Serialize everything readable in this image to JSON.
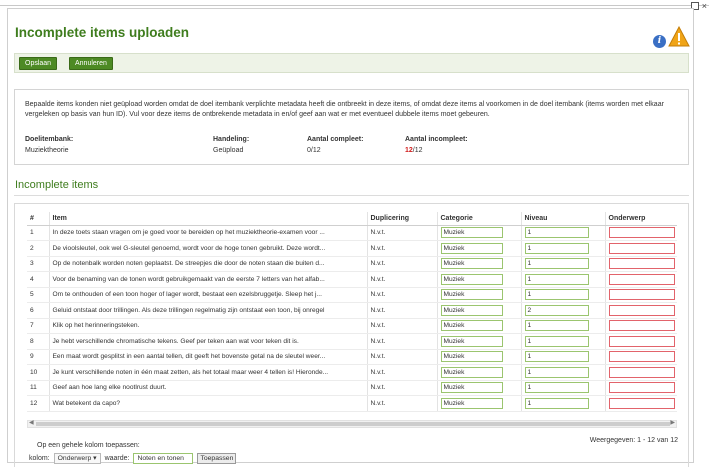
{
  "window": {
    "maximize_glyph": "□",
    "close_glyph": "×"
  },
  "page": {
    "title": "Incomplete items uploaden"
  },
  "icons": {
    "info": "info-icon",
    "warning": "warning-icon"
  },
  "toolbar": {
    "save_label": "Opslaan",
    "cancel_label": "Annuleren"
  },
  "info": {
    "text": "Bepaalde items konden niet geüpload worden omdat de doel itembank verplichte metadata heeft die ontbreekt in deze items, of omdat deze items al voorkomen in de doel itembank (items worden met elkaar vergeleken op basis van hun ID). Vul voor deze items de ontbrekende metadata in en/of geef aan wat er met eventueel dubbele items moet gebeuren.",
    "doel_label": "Doelitembank:",
    "doel_value": "Muziektheorie",
    "handeling_label": "Handeling:",
    "handeling_value": "Geüpload",
    "compleet_label": "Aantal compleet:",
    "compleet_value": "0/12",
    "incompleet_label": "Aantal incompleet:",
    "incompleet_red": "12",
    "incompleet_rest": "/12"
  },
  "section": {
    "title": "Incomplete items"
  },
  "table": {
    "headers": [
      "#",
      "Item",
      "Duplicering",
      "Categorie",
      "Niveau",
      "Onderwerp"
    ],
    "rows": [
      {
        "n": "1",
        "item": "In deze toets staan vragen om je goed voor te bereiden op het muziektheorie-examen voor ...",
        "dup": "N.v.t.",
        "cat": "Muziek",
        "niv": "1",
        "ond": ""
      },
      {
        "n": "2",
        "item": "De vioolsleutel, ook wel G-sleutel genoemd, wordt voor de hoge tonen gebruikt. Deze wordt...",
        "dup": "N.v.t.",
        "cat": "Muziek",
        "niv": "1",
        "ond": ""
      },
      {
        "n": "3",
        "item": "Op de notenbalk worden noten geplaatst. De streepjes die door de noten staan die buiten d...",
        "dup": "N.v.t.",
        "cat": "Muziek",
        "niv": "1",
        "ond": ""
      },
      {
        "n": "4",
        "item": "Voor de benaming van de tonen wordt gebruikgemaakt van de eerste 7 letters van het alfab...",
        "dup": "N.v.t.",
        "cat": "Muziek",
        "niv": "1",
        "ond": ""
      },
      {
        "n": "5",
        "item": "Om te onthouden of een toon hoger of lager wordt, bestaat een ezelsbruggetje. Sleep het j...",
        "dup": "N.v.t.",
        "cat": "Muziek",
        "niv": "1",
        "ond": ""
      },
      {
        "n": "6",
        "item": "Geluid ontstaat door trillingen. Als deze trillingen regelmatig zijn ontstaat een toon, bij onregel",
        "dup": "N.v.t.",
        "cat": "Muziek",
        "niv": "2",
        "ond": ""
      },
      {
        "n": "7",
        "item": "Klik op het herinneringsteken.",
        "dup": "N.v.t.",
        "cat": "Muziek",
        "niv": "1",
        "ond": ""
      },
      {
        "n": "8",
        "item": "Je hebt verschillende chromatische tekens.  Geef per teken aan wat voor teken dit is.",
        "dup": "N.v.t.",
        "cat": "Muziek",
        "niv": "1",
        "ond": ""
      },
      {
        "n": "9",
        "item": "Een maat wordt gesplitst in een aantal tellen, dit geeft het bovenste getal na de sleutel weer...",
        "dup": "N.v.t.",
        "cat": "Muziek",
        "niv": "1",
        "ond": ""
      },
      {
        "n": "10",
        "item": "Je kunt verschillende noten in één maat zetten, als het totaal maar weer 4 tellen is! Hieronde...",
        "dup": "N.v.t.",
        "cat": "Muziek",
        "niv": "1",
        "ond": ""
      },
      {
        "n": "11",
        "item": "Geef aan hoe lang elke nootlrust duurt.",
        "dup": "N.v.t.",
        "cat": "Muziek",
        "niv": "1",
        "ond": ""
      },
      {
        "n": "12",
        "item": "Wat betekent da capo?",
        "dup": "N.v.t.",
        "cat": "Muziek",
        "niv": "1",
        "ond": ""
      }
    ]
  },
  "pager": {
    "shown": "Weergegeven: 1 - 12 van 12"
  },
  "bulk": {
    "label": "Op een gehele kolom toepassen:",
    "kolom_label": "kolom:",
    "kolom_value": "Onderwerp",
    "waarde_label": "waarde:",
    "waarde_value": "Noten en tonen",
    "apply_label": "Toepassen"
  },
  "colors": {
    "accent_green": "#3f7d1e",
    "button_green": "#4d8a24",
    "error_red": "#d01b1b"
  }
}
